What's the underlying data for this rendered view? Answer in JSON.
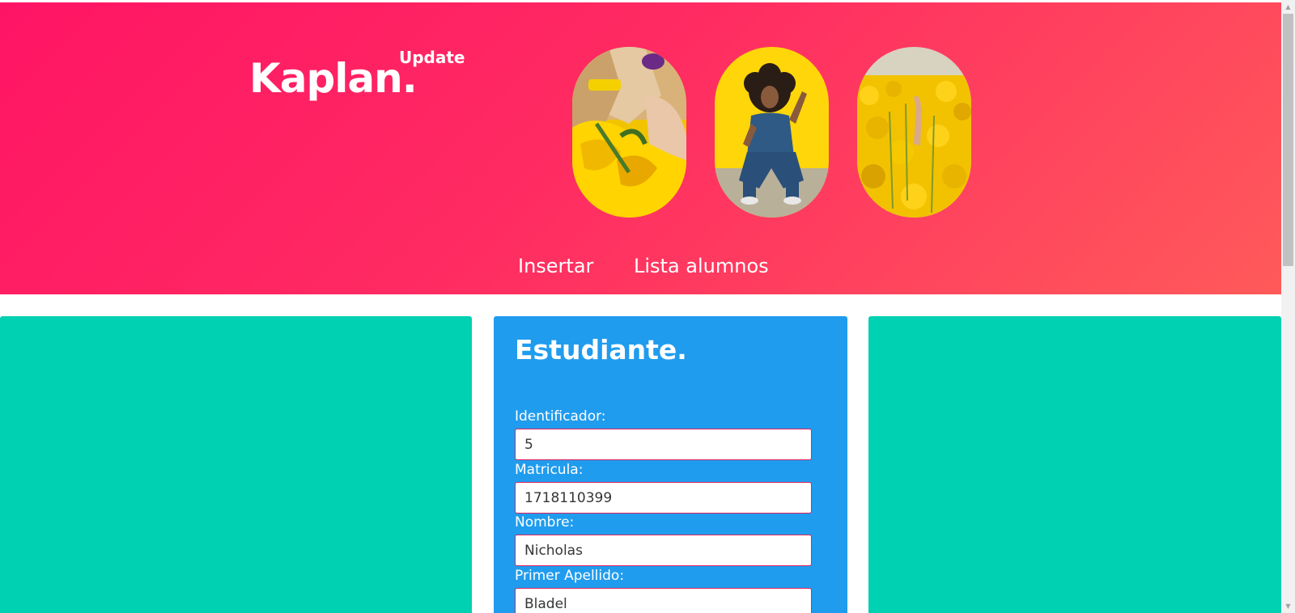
{
  "header": {
    "brand": "Kaplan.",
    "badge": "Update",
    "gradient_colors": [
      "#ff1465",
      "#ff5a5a"
    ],
    "photos": [
      {
        "icon": "woman-yellow-flowers-photo"
      },
      {
        "icon": "woman-curly-hair-photo"
      },
      {
        "icon": "yellow-field-hand-photo"
      }
    ]
  },
  "nav": {
    "items": [
      {
        "label": "Insertar"
      },
      {
        "label": "Lista alumnos"
      }
    ]
  },
  "form": {
    "title": "Estudiante.",
    "fields": [
      {
        "label": "Identificador:",
        "value": "5"
      },
      {
        "label": "Matricula:",
        "value": "1718110399"
      },
      {
        "label": "Nombre:",
        "value": "Nicholas"
      },
      {
        "label": "Primer Apellido:",
        "value": "Bladel"
      }
    ]
  },
  "colors": {
    "side_panels": "#00d1b2",
    "form_panel": "#209cee",
    "input_border": "#e0245e"
  }
}
